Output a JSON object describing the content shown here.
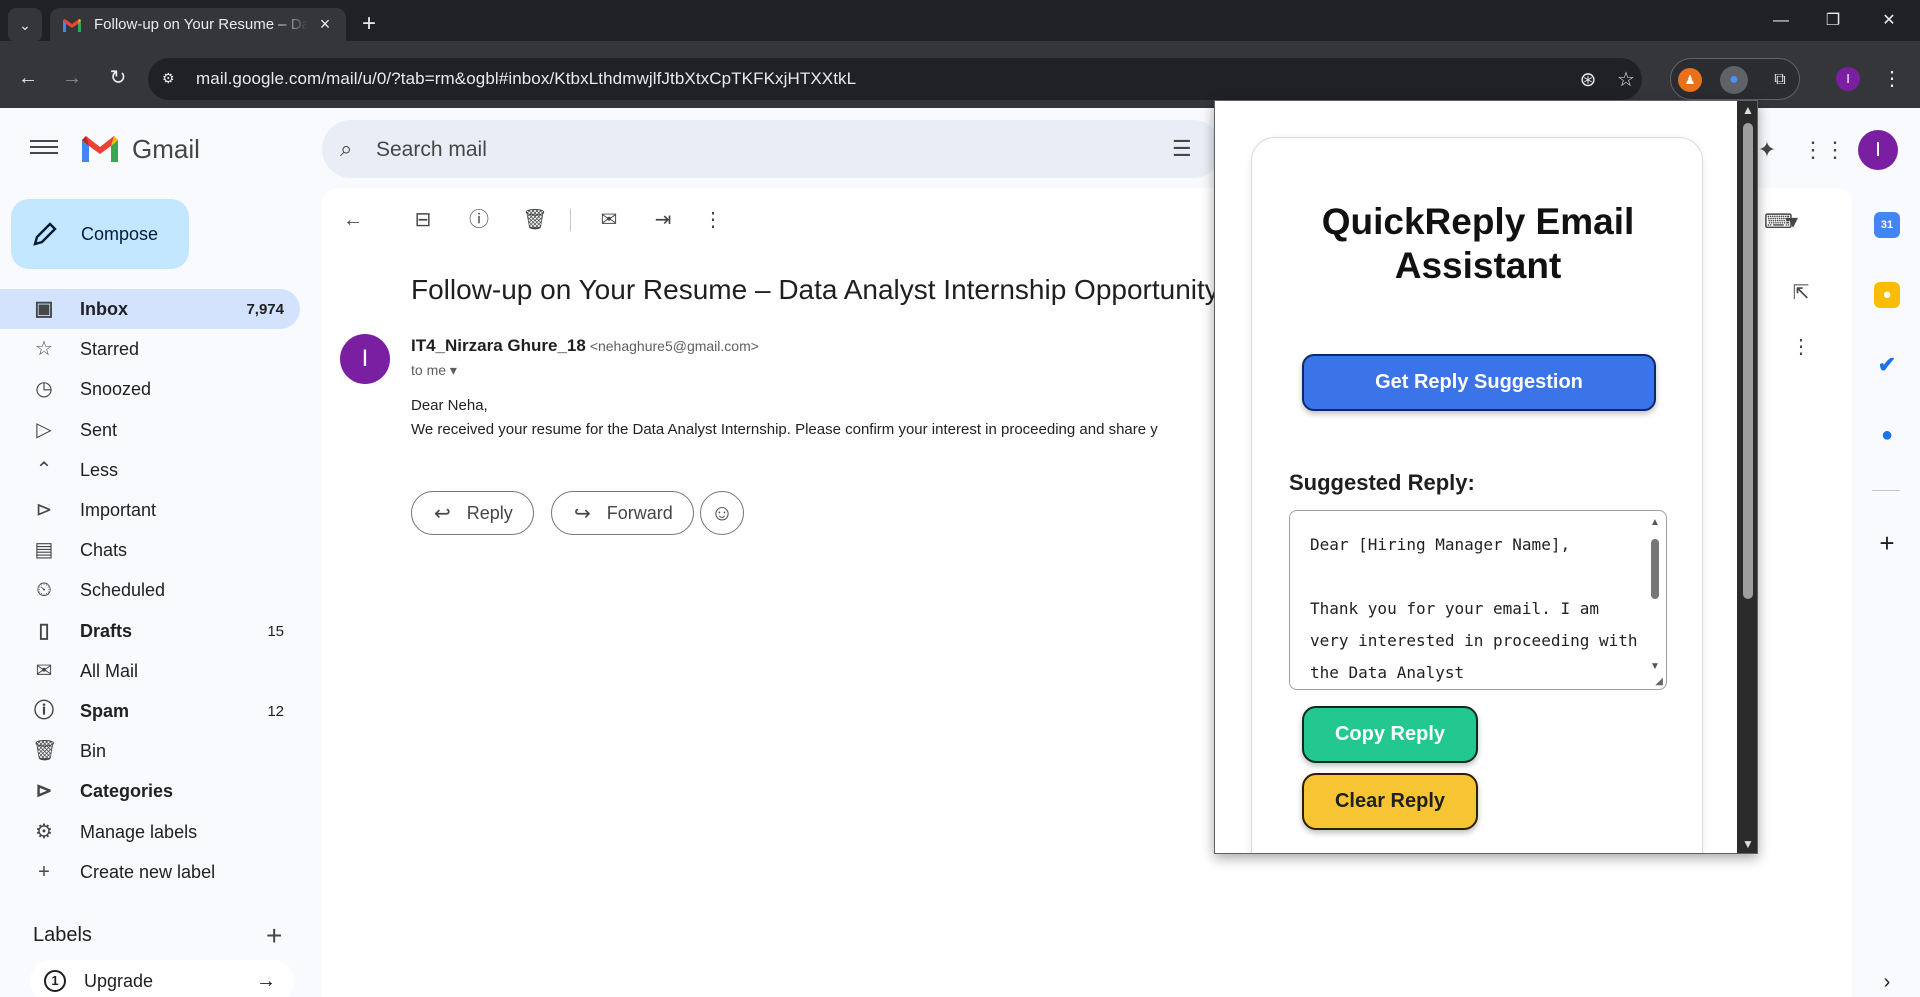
{
  "browser": {
    "tab_title": "Follow-up on Your Resume – Da",
    "url": "mail.google.com/mail/u/0/?tab=rm&ogbl#inbox/KtbxLthdmwjlfJtbXtxCpTKFKxjHTXXtkL",
    "profile_initial": "I"
  },
  "gmail": {
    "wordmark": "Gmail",
    "search_placeholder": "Search mail",
    "compose_label": "Compose",
    "account_initial": "I",
    "nav": [
      {
        "label": "Inbox",
        "count": "7,974",
        "icon": "inbox-icon"
      },
      {
        "label": "Starred",
        "count": "",
        "icon": "star-icon"
      },
      {
        "label": "Snoozed",
        "count": "",
        "icon": "clock-icon"
      },
      {
        "label": "Sent",
        "count": "",
        "icon": "send-icon"
      },
      {
        "label": "Less",
        "count": "",
        "icon": "chevron-up-icon"
      },
      {
        "label": "Important",
        "count": "",
        "icon": "important-icon"
      },
      {
        "label": "Chats",
        "count": "",
        "icon": "chat-icon"
      },
      {
        "label": "Scheduled",
        "count": "",
        "icon": "scheduled-icon"
      },
      {
        "label": "Drafts",
        "count": "15",
        "icon": "draft-icon"
      },
      {
        "label": "All Mail",
        "count": "",
        "icon": "all-mail-icon"
      },
      {
        "label": "Spam",
        "count": "12",
        "icon": "spam-icon"
      },
      {
        "label": "Bin",
        "count": "",
        "icon": "trash-icon"
      },
      {
        "label": "Categories",
        "count": "",
        "icon": "label-icon"
      },
      {
        "label": "Manage labels",
        "count": "",
        "icon": "gear-icon"
      },
      {
        "label": "Create new label",
        "count": "",
        "icon": "plus-icon"
      }
    ],
    "labels_heading": "Labels",
    "upgrade_label": "Upgrade"
  },
  "email": {
    "subject": "Follow-up on Your Resume – Data Analyst Internship Opportunity",
    "sender_name": "IT4_Nirzara Ghure_18",
    "sender_email": "<nehaghure5@gmail.com>",
    "sender_initial": "I",
    "to": "to me",
    "greeting": "Dear Neha,",
    "body": "We received your resume for the Data Analyst Internship. Please confirm your interest in proceeding and share y",
    "reply_label": "Reply",
    "forward_label": "Forward"
  },
  "extension": {
    "title": "QuickReply Email Assistant",
    "suggest_button": "Get Reply Suggestion",
    "suggested_label": "Suggested Reply:",
    "reply_text": "Dear [Hiring Manager Name],\n\nThank you for your email. I am very interested in proceeding with the Data Analyst",
    "copy_button": "Copy Reply",
    "clear_button": "Clear Reply"
  },
  "colors": {
    "gmail_active_nav": "#d3e3fd",
    "compose_bg": "#c2e7ff",
    "avatar": "#7b1fa2",
    "suggest_button": "#3a74e8",
    "copy_button": "#22c88f",
    "clear_button": "#f7c533"
  }
}
